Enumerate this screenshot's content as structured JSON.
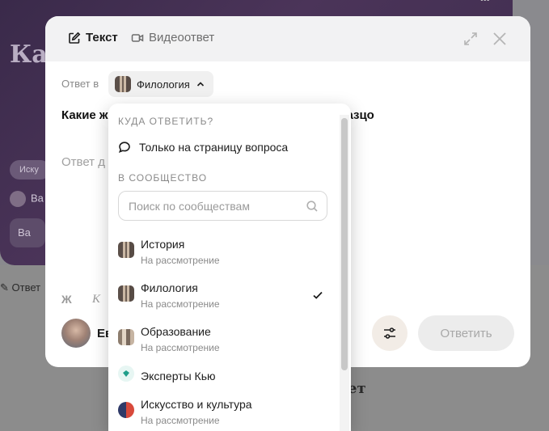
{
  "background": {
    "title": "Как литературные образцы ден",
    "tag": "Иску",
    "user": "Ва",
    "card": "Ва",
    "answer_button": "Ответ",
    "heading": "ет"
  },
  "modal": {
    "tabs": [
      {
        "label": "Текст",
        "icon": "edit-icon",
        "active": true
      },
      {
        "label": "Видеоответ",
        "icon": "video-camera-icon",
        "active": false
      }
    ],
    "reply_to_label": "Ответ в",
    "selected_community": "Филология",
    "question": "Какие ж                                     могут служить образцо",
    "answer_placeholder": "Ответ д",
    "format": {
      "bold": "Ж",
      "italic": "К"
    },
    "author_name": "Ев",
    "submit_label": "Ответить"
  },
  "dropdown": {
    "section_where": "КУДА ОТВЕТИТЬ?",
    "question_only": "Только на страницу вопроса",
    "section_community": "В СООБЩЕСТВО",
    "search_placeholder": "Поиск по сообществам",
    "items": [
      {
        "name": "История",
        "status": "На рассмотрение",
        "icon": "history-community-icon"
      },
      {
        "name": "Филология",
        "status": "На рассмотрение",
        "icon": "philology-community-icon",
        "selected": true
      },
      {
        "name": "Образование",
        "status": "На рассмотрение",
        "icon": "education-community-icon"
      },
      {
        "name": "Эксперты Кью",
        "status": "",
        "icon": "experts-community-icon"
      },
      {
        "name": "Искусство и культура",
        "status": "На рассмотрение",
        "icon": "art-community-icon"
      }
    ]
  },
  "colors": {
    "overlay": "#8a8a8e",
    "header_bg": "#f2f2f3",
    "submit_disabled_bg": "#ececec",
    "settings_bg": "#f2ece6"
  }
}
